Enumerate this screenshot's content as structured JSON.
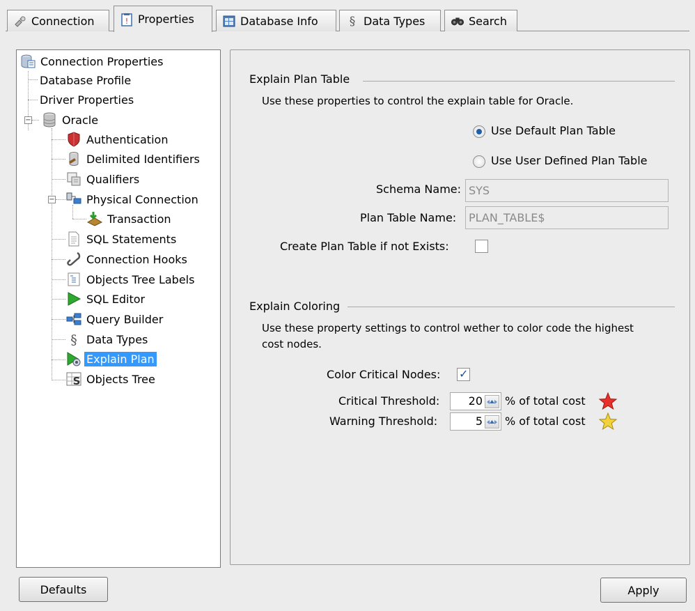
{
  "tabs": [
    {
      "label": "Connection",
      "icon": "plug-icon"
    },
    {
      "label": "Properties",
      "icon": "properties-sheet-icon"
    },
    {
      "label": "Database Info",
      "icon": "database-info-icon"
    },
    {
      "label": "Data Types",
      "icon": "data-types-icon"
    },
    {
      "label": "Search",
      "icon": "binoculars-icon"
    }
  ],
  "active_tab": "Properties",
  "tree": {
    "items": [
      {
        "label": "Connection Properties",
        "icon": "connection-properties-icon"
      },
      {
        "label": "Database Profile"
      },
      {
        "label": "Driver Properties"
      },
      {
        "label": "Oracle",
        "icon": "database-icon"
      },
      {
        "label": "Authentication",
        "icon": "shield-icon"
      },
      {
        "label": "Delimited Identifiers",
        "icon": "delimited-identifiers-icon"
      },
      {
        "label": "Qualifiers",
        "icon": "qualifiers-icon"
      },
      {
        "label": "Physical Connection",
        "icon": "network-icon"
      },
      {
        "label": "Transaction",
        "icon": "transaction-icon"
      },
      {
        "label": "SQL Statements",
        "icon": "document-icon"
      },
      {
        "label": "Connection Hooks",
        "icon": "hook-icon"
      },
      {
        "label": "Objects Tree Labels",
        "icon": "tree-labels-icon"
      },
      {
        "label": "SQL Editor",
        "icon": "play-icon"
      },
      {
        "label": "Query Builder",
        "icon": "query-builder-icon"
      },
      {
        "label": "Data Types",
        "icon": "data-types-icon"
      },
      {
        "label": "Explain Plan",
        "icon": "explain-plan-icon"
      },
      {
        "label": "Objects Tree",
        "icon": "objects-tree-icon"
      }
    ],
    "selected": "Explain Plan"
  },
  "explain_plan_table": {
    "title": "Explain Plan Table",
    "description": "Use these properties to control the explain table for Oracle.",
    "radio_default": "Use Default Plan Table",
    "radio_user": "Use User Defined Plan Table",
    "selected_radio": "Use Default Plan Table",
    "schema_label": "Schema Name:",
    "schema_value": "SYS",
    "plan_table_label": "Plan Table Name:",
    "plan_table_value": "PLAN_TABLE$",
    "create_label": "Create Plan Table if not Exists:",
    "create_checked": false
  },
  "explain_coloring": {
    "title": "Explain Coloring",
    "description_line1": "Use these property settings to control wether to color code the highest",
    "description_line2": "cost nodes.",
    "color_critical_label": "Color Critical Nodes:",
    "color_critical_checked": true,
    "critical_label": "Critical Threshold:",
    "critical_value": "20",
    "critical_suffix": "% of total cost",
    "warning_label": "Warning Threshold:",
    "warning_value": "5",
    "warning_suffix": "% of total cost",
    "critical_star_color": "#e8302a",
    "warning_star_color": "#f2d23c"
  },
  "buttons": {
    "defaults": "Defaults",
    "apply": "Apply"
  },
  "colors": {
    "selection": "#3399ff",
    "background": "#ececec"
  }
}
